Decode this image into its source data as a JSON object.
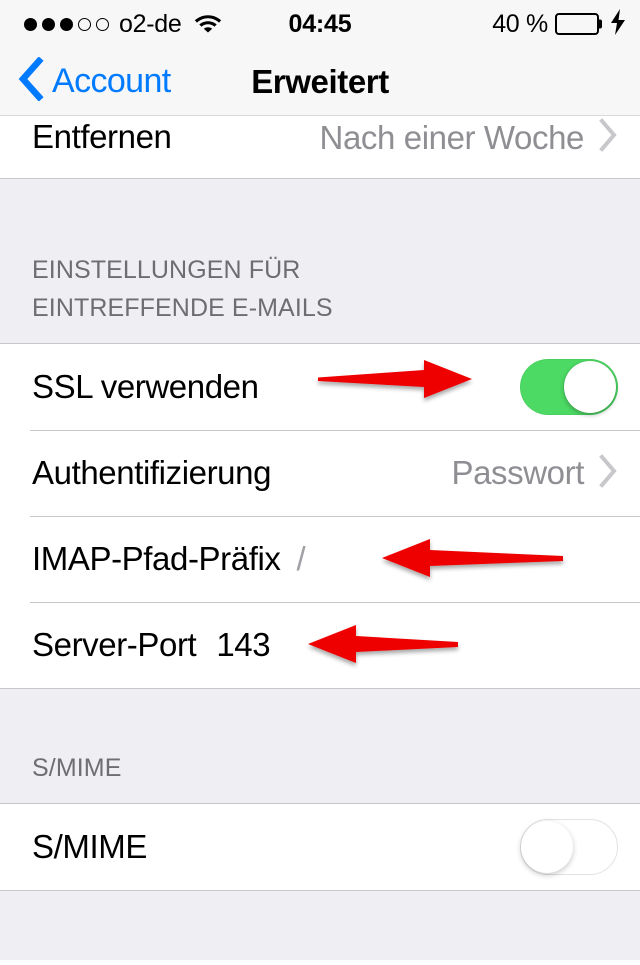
{
  "status_bar": {
    "signal_dots_filled": 3,
    "signal_dots_empty": 2,
    "carrier": "o2-de",
    "wifi_icon": "wifi-icon",
    "time": "04:45",
    "battery_percent_label": "40 %",
    "battery_level": 40,
    "charging_icon": "lightning-bolt-icon",
    "battery_color": "#4cd964"
  },
  "nav_bar": {
    "back_label": "Account",
    "back_icon": "chevron-left-icon",
    "title": "Erweitert",
    "tint_color": "#007aff"
  },
  "sections": [
    {
      "header": null,
      "rows": [
        {
          "label": "Entfernen",
          "value": "Nach einer Woche",
          "accessory": "chevron-right-icon"
        }
      ]
    },
    {
      "header_lines": [
        "EINSTELLUNGEN FÜR",
        "EINTREFFENDE E-MAILS"
      ],
      "rows": [
        {
          "label": "SSL verwenden",
          "accessory": "toggle",
          "toggle_state": "on"
        },
        {
          "label": "Authentifizierung",
          "value": "Passwort",
          "accessory": "chevron-right-icon"
        },
        {
          "label": "IMAP-Pfad-Präfix",
          "inline_value": "/"
        },
        {
          "label": "Server-Port",
          "inline_value": "143"
        }
      ]
    },
    {
      "header_lines": [
        "S/MIME"
      ],
      "rows": [
        {
          "label": "S/MIME",
          "accessory": "toggle",
          "toggle_state": "off"
        }
      ]
    }
  ],
  "annotations": {
    "color": "#ee0000",
    "arrows": [
      {
        "name": "arrow-to-ssl-toggle",
        "direction": "right",
        "target": "SSL verwenden toggle"
      },
      {
        "name": "arrow-to-imap-prefix",
        "direction": "left",
        "target": "IMAP-Pfad-Präfix value"
      },
      {
        "name": "arrow-to-server-port",
        "direction": "left",
        "target": "Server-Port value"
      }
    ]
  }
}
